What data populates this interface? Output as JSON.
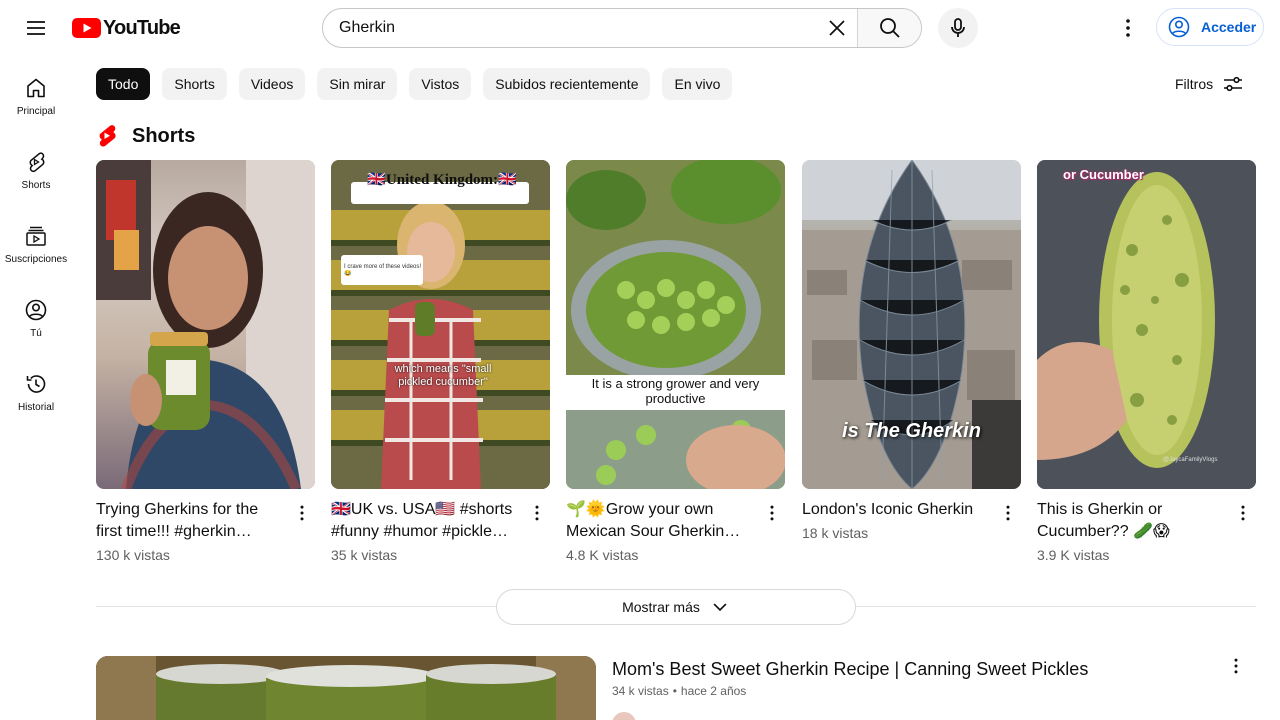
{
  "header": {
    "logo_text": "YouTube",
    "search_value": "Gherkin",
    "signin_label": "Acceder"
  },
  "sidebar": {
    "items": [
      {
        "label": "Principal",
        "icon": "home-icon"
      },
      {
        "label": "Shorts",
        "icon": "shorts-icon"
      },
      {
        "label": "Suscripciones",
        "icon": "subscriptions-icon"
      },
      {
        "label": "Tú",
        "icon": "you-icon"
      },
      {
        "label": "Historial",
        "icon": "history-icon"
      }
    ]
  },
  "chips": [
    "Todo",
    "Shorts",
    "Videos",
    "Sin mirar",
    "Vistos",
    "Subidos recientemente",
    "En vivo"
  ],
  "filters_label": "Filtros",
  "shorts": {
    "title": "Shorts",
    "items": [
      {
        "title": "Trying Gherkins for the first time!!! #gherkin #cucumber",
        "views": "130 k vistas",
        "overlay": ""
      },
      {
        "title": "🇬🇧UK vs. USA🇺🇸 #shorts #funny #humor #pickle #gherkin",
        "views": "35 k vistas",
        "overlay": "🇬🇧United Kingdom:🇬🇧",
        "overlay2": "which means \"small pickled cucumber\"",
        "reply": "I crave more of these videos! 😂"
      },
      {
        "title": "🌱🌞Grow your own Mexican Sour Gherkin cucumbers",
        "views": "4.8 K vistas",
        "overlay": "It is a strong grower and very productive"
      },
      {
        "title": "London's Iconic Gherkin",
        "views": "18 k vistas",
        "overlay": "is The Gherkin"
      },
      {
        "title": "This is Gherkin or Cucumber?? 🥒😱",
        "views": "3.9 K vistas",
        "overlay": "or Cucumber",
        "watermark": "@JaycaFamilyVlogs"
      }
    ],
    "show_more_label": "Mostrar más"
  },
  "video": {
    "title": "Mom's Best Sweet Gherkin Recipe | Canning Sweet Pickles",
    "views": "34 k vistas",
    "separator": "•",
    "age": "hace 2 años"
  },
  "colors": {
    "brand_red": "#ff0000",
    "link_blue": "#065fd4",
    "chip_bg": "#f2f2f2",
    "chip_active_bg": "#0f0f0f",
    "secondary_text": "#606060"
  }
}
